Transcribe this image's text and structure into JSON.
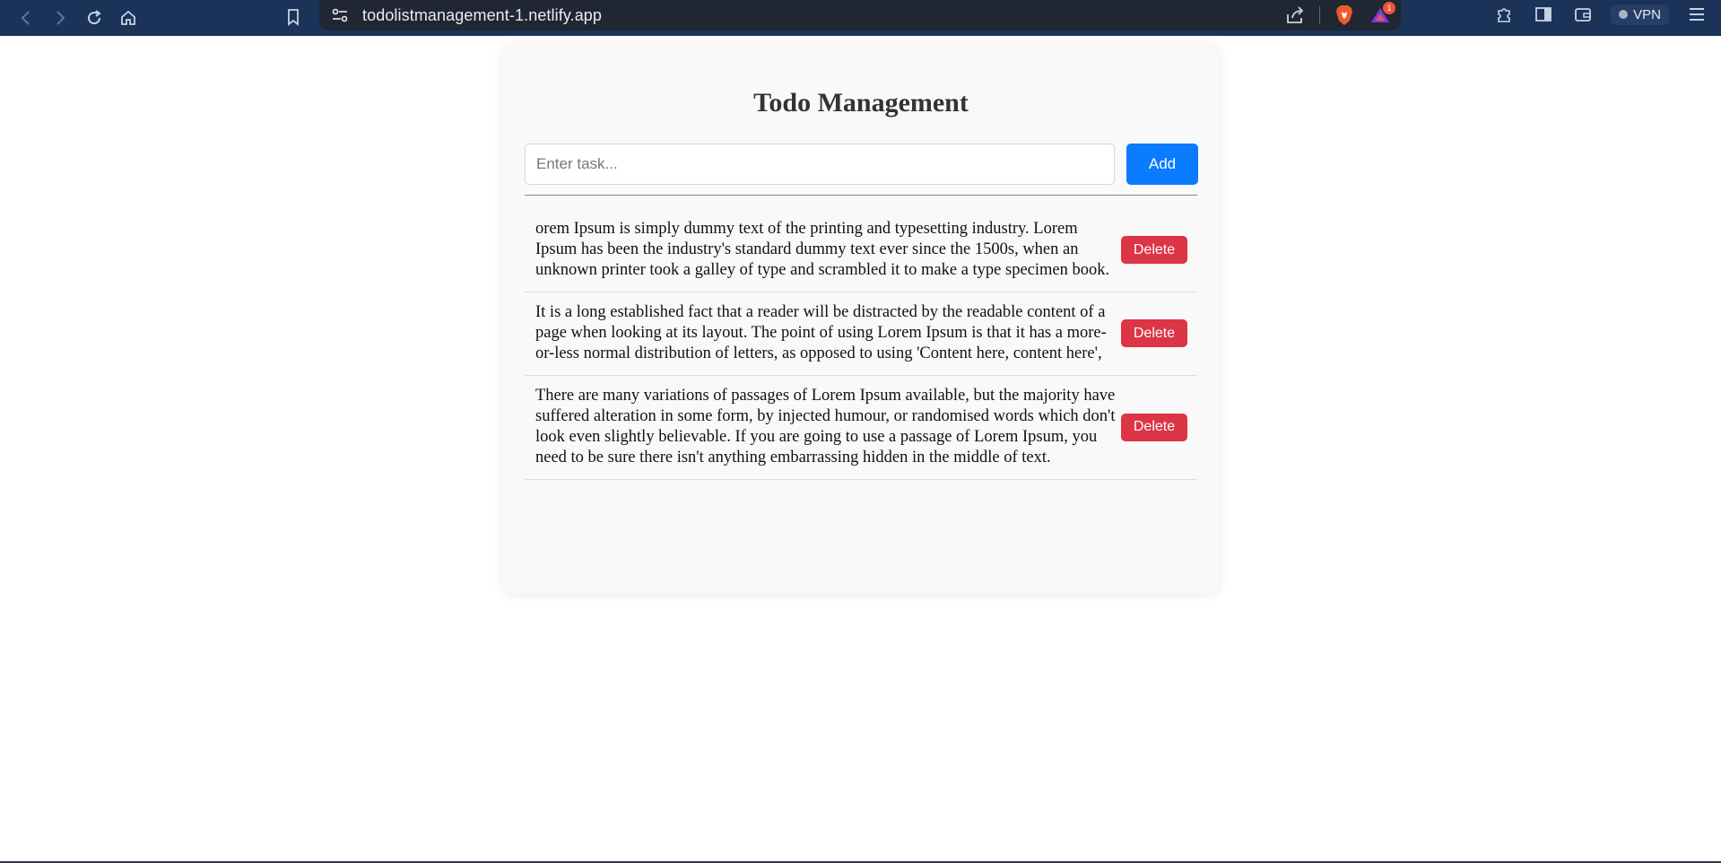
{
  "browser": {
    "url": "todolistmanagement-1.netlify.app",
    "rewards_badge": "1",
    "vpn_label": "VPN",
    "icons": [
      "back-icon",
      "forward-icon",
      "reload-icon",
      "home-icon",
      "bookmark-icon",
      "site-info-icon",
      "share-icon",
      "brave-shields-icon",
      "brave-rewards-icon",
      "extensions-icon",
      "sidebar-icon",
      "wallet-icon",
      "menu-icon"
    ]
  },
  "app": {
    "title": "Todo Management",
    "input": {
      "value": "",
      "placeholder": "Enter task..."
    },
    "add_label": "Add",
    "todos": [
      {
        "text": "orem Ipsum is simply dummy text of the printing and typesetting industry. Lorem Ipsum has been the industry's standard dummy text ever since the 1500s, when an unknown printer took a galley of type and scrambled it to make a type specimen book.",
        "delete_label": "Delete"
      },
      {
        "text": "It is a long established fact that a reader will be distracted by the readable content of a page when looking at its layout. The point of using Lorem Ipsum is that it has a more-or-less normal distribution of letters, as opposed to using 'Content here, content here',",
        "delete_label": "Delete"
      },
      {
        "text": "There are many variations of passages of Lorem Ipsum available, but the majority have suffered alteration in some form, by injected humour, or randomised words which don't look even slightly believable. If you are going to use a passage of Lorem Ipsum, you need to be sure there isn't anything embarrassing hidden in the middle of text.",
        "delete_label": "Delete"
      }
    ]
  },
  "colors": {
    "browser_bar": "#1b3358",
    "address_bar": "#202733",
    "card_background": "#f9f9f9",
    "add_button": "#0b7bff",
    "delete_button": "#dc3545",
    "title_text": "#333333"
  }
}
